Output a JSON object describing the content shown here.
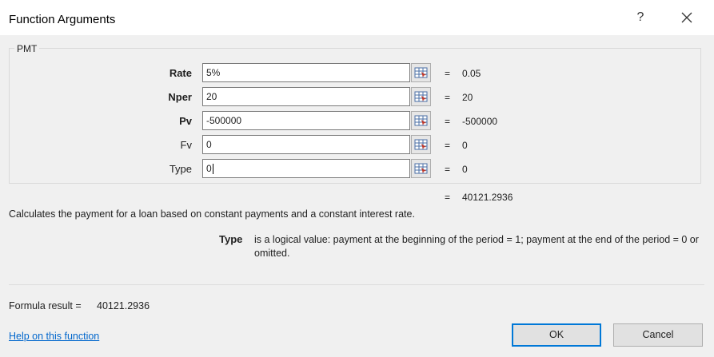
{
  "dialog": {
    "title": "Function Arguments",
    "help_glyph": "?",
    "close_icon": "close-icon"
  },
  "function_name": "PMT",
  "arguments": [
    {
      "label": "Rate",
      "bold": true,
      "value": "5%",
      "evaluated": "0.05"
    },
    {
      "label": "Nper",
      "bold": true,
      "value": "20",
      "evaluated": "20"
    },
    {
      "label": "Pv",
      "bold": true,
      "value": "-500000",
      "evaluated": "-500000"
    },
    {
      "label": "Fv",
      "bold": false,
      "value": "0",
      "evaluated": "0"
    },
    {
      "label": "Type",
      "bold": false,
      "value": "0",
      "evaluated": "0"
    }
  ],
  "equals": "=",
  "result_preview": "40121.2936",
  "description": "Calculates the payment for a loan based on constant payments and a constant interest rate.",
  "selected_argument": {
    "name": "Type",
    "description": "is a logical value: payment at the beginning of the period = 1; payment at the end of the period = 0 or omitted."
  },
  "formula_result": {
    "label": "Formula result =",
    "value": "40121.2936"
  },
  "help_link": "Help on this function",
  "buttons": {
    "ok": "OK",
    "cancel": "Cancel"
  },
  "colors": {
    "accent": "#0078d7",
    "link": "#0066cc"
  }
}
